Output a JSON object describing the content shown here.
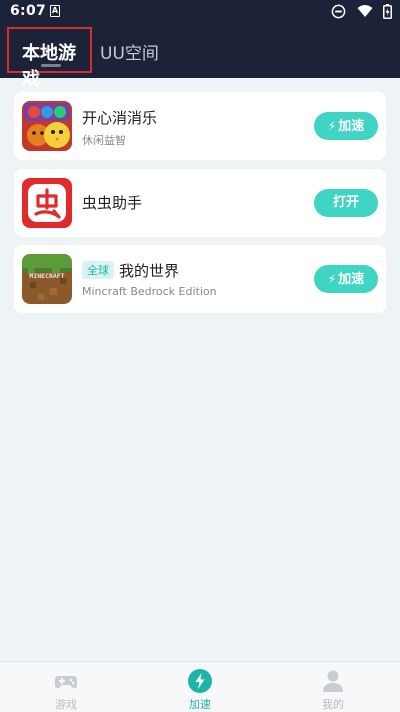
{
  "status_bar": {
    "time": "6:07",
    "notification_icon": "A",
    "icons": [
      "do-not-disturb-icon",
      "wifi-icon",
      "battery-charging-icon"
    ]
  },
  "header": {
    "tabs": [
      {
        "label": "本地游戏",
        "active": true
      },
      {
        "label": "UU空间",
        "active": false
      }
    ]
  },
  "games": [
    {
      "title": "开心消消乐",
      "subtitle": "休闲益智",
      "badge": "",
      "button": "加速",
      "icon": "happy-match-icon"
    },
    {
      "title": "虫虫助手",
      "subtitle": "",
      "badge": "",
      "button": "打开",
      "icon": "chongchong-icon"
    },
    {
      "title": "我的世界",
      "subtitle": "Mincraft Bedrock Edition",
      "badge": "全球",
      "button": "加速",
      "icon": "minecraft-icon",
      "icon_text": "MINECRAFT"
    }
  ],
  "bottom_nav": {
    "items": [
      {
        "label": "游戏",
        "icon": "gamepad-icon",
        "active": false
      },
      {
        "label": "加速",
        "icon": "bolt-icon",
        "active": true
      },
      {
        "label": "我的",
        "icon": "person-icon",
        "active": false
      }
    ]
  },
  "colors": {
    "header_bg": "#1c2238",
    "accent": "#40d4c4",
    "active_text": "#1fb5a6",
    "page_bg": "#eef3f5"
  }
}
